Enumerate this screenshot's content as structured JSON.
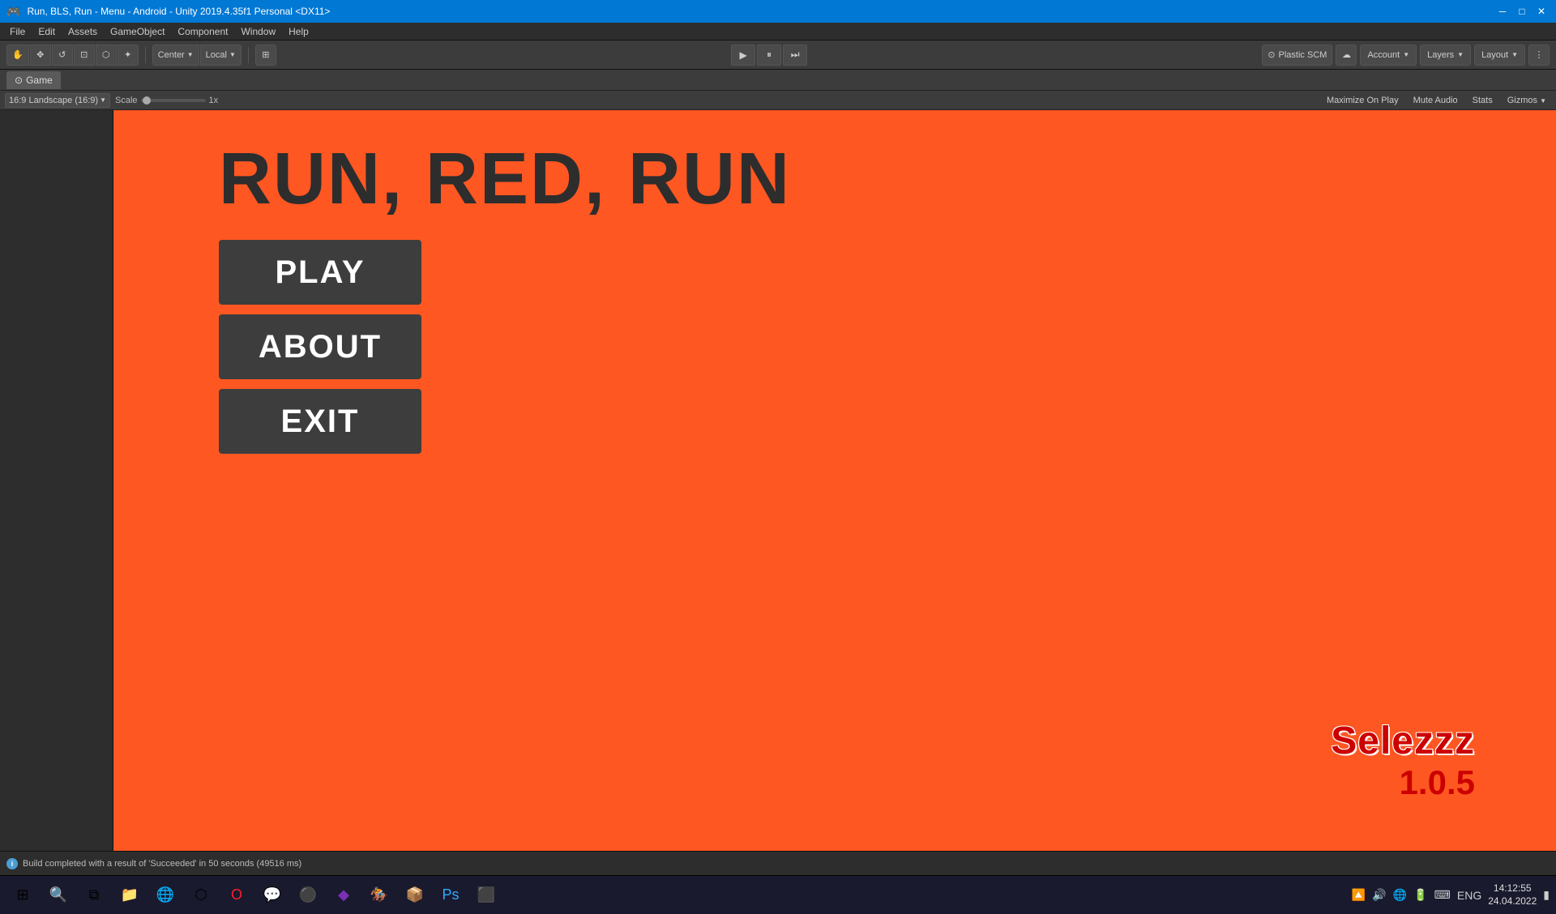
{
  "titleBar": {
    "title": "Run, BLS, Run - Menu - Android - Unity 2019.4.35f1 Personal <DX11>",
    "controls": {
      "minimize": "─",
      "maximize": "□",
      "close": "✕"
    }
  },
  "menuBar": {
    "items": [
      "File",
      "Edit",
      "Assets",
      "GameObject",
      "Component",
      "Window",
      "Help"
    ]
  },
  "toolbar": {
    "tools": [
      "✋",
      "✥",
      "↔",
      "↺",
      "⊡",
      "⬡"
    ],
    "transform": [
      "Center",
      "Local"
    ],
    "playControls": {
      "play": "▶",
      "pause": "⏸",
      "step": "⏭"
    },
    "plasticScm": "⊙ Plastic SCM",
    "cloudIcon": "☁",
    "account": "Account",
    "layers": "Layers",
    "layout": "Layout",
    "moreOptions": "⋮"
  },
  "gameView": {
    "tabLabel": "Game",
    "tabIcon": "⊙",
    "resolution": "16:9 Landscape (16:9)",
    "scaleLabel": "Scale",
    "scaleValue": "1x",
    "rightControls": {
      "maximizeOnPlay": "Maximize On Play",
      "muteAudio": "Mute Audio",
      "stats": "Stats",
      "gizmos": "Gizmos"
    }
  },
  "gameContent": {
    "title": "RUN, RED, RUN",
    "buttons": [
      {
        "label": "PLAY"
      },
      {
        "label": "ABOUT"
      },
      {
        "label": "EXIT"
      }
    ],
    "brandName": "Selezzz",
    "brandVersion": "1.0.5",
    "backgroundColor": "#ff5722"
  },
  "statusBar": {
    "message": "Build completed with a result of 'Succeeded' in 50 seconds (49516 ms)"
  },
  "taskbar": {
    "startIcon": "⊞",
    "items": [
      {
        "icon": "📁",
        "name": "file-explorer"
      },
      {
        "icon": "🌐",
        "name": "browser"
      },
      {
        "icon": "🎨",
        "name": "paint"
      },
      {
        "icon": "🔴",
        "name": "opera"
      },
      {
        "icon": "💬",
        "name": "messenger"
      },
      {
        "icon": "🎯",
        "name": "unity-hub"
      },
      {
        "icon": "🔷",
        "name": "visual-studio"
      },
      {
        "icon": "🟢",
        "name": "rider"
      },
      {
        "icon": "📦",
        "name": "package-manager"
      },
      {
        "icon": "🔵",
        "name": "photoshop"
      },
      {
        "icon": "⬛",
        "name": "app"
      }
    ],
    "tray": {
      "time": "14:12:55",
      "date": "24.04.2022",
      "language": "ENG"
    }
  }
}
